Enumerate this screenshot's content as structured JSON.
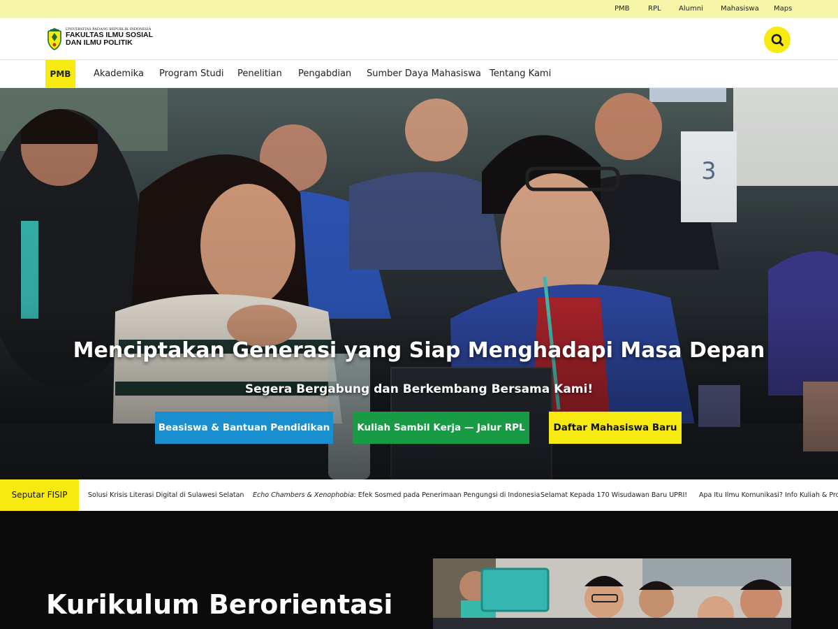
{
  "topbar": {
    "links": [
      "PMB",
      "RPL",
      "Alumni",
      "Mahasiswa",
      "Maps"
    ]
  },
  "header": {
    "logo_small": "UNIVERSITAS PADANG REPUBLIK INDONESIA",
    "logo_line1": "FAKULTAS ILMU SOSIAL",
    "logo_line2": "DAN ILMU POLITIK",
    "search_icon": "search-icon"
  },
  "nav": {
    "pmb": "PMB",
    "items": [
      "Akademika",
      "Program Studi",
      "Penelitian",
      "Pengabdian",
      "Sumber Daya Mahasiswa",
      "Tentang Kami"
    ]
  },
  "hero": {
    "title": "Menciptakan Generasi yang Siap Menghadapi Masa Depan",
    "subtitle": "Segera Bergabung dan Berkembang Bersama Kami!",
    "buttons": {
      "scholarship": "Beasiswa & Bantuan Pendidikan",
      "rpl": "Kuliah Sambil Kerja — Jalur RPL",
      "register": "Daftar Mahasiswa Baru"
    },
    "table_number": "3"
  },
  "ticker": {
    "label": "Seputar FISIP",
    "item1": "Solusi Krisis Literasi Digital di Sulawesi Selatan",
    "item2_em": "Echo Chambers & Xenophobia",
    "item2_rest": ": Efek Sosmed pada Penerimaan Pengungsi di Indonesia",
    "item3": "Selamat Kepada 170 Wisudawan Baru UPRI!",
    "item4": "Apa Itu Ilmu Komunikasi? Info Kuliah & Prospek"
  },
  "section": {
    "title": "Kurikulum Berorientasi"
  },
  "colors": {
    "accent_yellow": "#f6ea10",
    "topbar_yellow": "#f7f5a8",
    "button_blue": "#1a8fd0",
    "button_green": "#179c45",
    "section_bg": "#0b0b0b"
  }
}
